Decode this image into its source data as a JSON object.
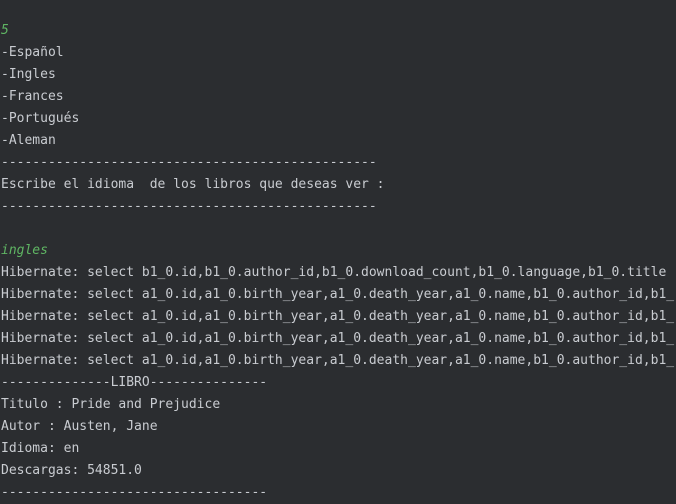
{
  "console": {
    "accent_input_color": "#5fb563",
    "text_color": "#c9ccd1",
    "background_color": "#2b2d30",
    "lines": [
      {
        "text": "5",
        "type": "input"
      },
      {
        "text": "-Español",
        "type": "output"
      },
      {
        "text": "-Ingles",
        "type": "output"
      },
      {
        "text": "-Frances",
        "type": "output"
      },
      {
        "text": "-Portugués",
        "type": "output"
      },
      {
        "text": "-Aleman",
        "type": "output"
      },
      {
        "text": "------------------------------------------------",
        "type": "output"
      },
      {
        "text": "Escribe el idioma  de los libros que deseas ver :",
        "type": "output"
      },
      {
        "text": "------------------------------------------------",
        "type": "output"
      },
      {
        "text": "",
        "type": "blank"
      },
      {
        "text": "ingles",
        "type": "input"
      },
      {
        "text": "Hibernate: select b1_0.id,b1_0.author_id,b1_0.download_count,b1_0.language,b1_0.title",
        "type": "log"
      },
      {
        "text": "Hibernate: select a1_0.id,a1_0.birth_year,a1_0.death_year,a1_0.name,b1_0.author_id,b1_",
        "type": "log"
      },
      {
        "text": "Hibernate: select a1_0.id,a1_0.birth_year,a1_0.death_year,a1_0.name,b1_0.author_id,b1_",
        "type": "log"
      },
      {
        "text": "Hibernate: select a1_0.id,a1_0.birth_year,a1_0.death_year,a1_0.name,b1_0.author_id,b1_",
        "type": "log"
      },
      {
        "text": "Hibernate: select a1_0.id,a1_0.birth_year,a1_0.death_year,a1_0.name,b1_0.author_id,b1_",
        "type": "log"
      },
      {
        "text": "--------------LIBRO---------------",
        "type": "output"
      },
      {
        "text": "Titulo : Pride and Prejudice",
        "type": "output"
      },
      {
        "text": "Autor : Austen, Jane",
        "type": "output"
      },
      {
        "text": "Idioma: en",
        "type": "output"
      },
      {
        "text": "Descargas: 54851.0",
        "type": "output"
      },
      {
        "text": "----------------------------------",
        "type": "output"
      }
    ]
  }
}
